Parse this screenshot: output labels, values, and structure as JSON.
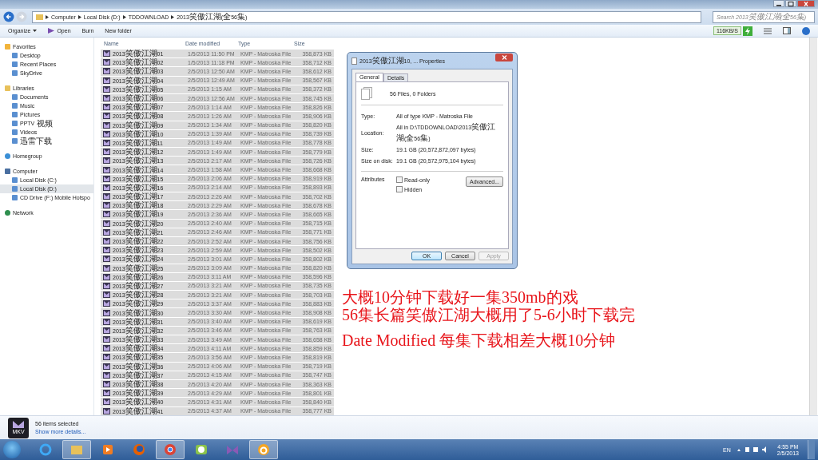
{
  "address_bar": {
    "breadcrumbs": [
      "Computer",
      "Local Disk (D:)",
      "TDDOWNLOAD",
      "2013笑傲江湖(全56集)"
    ],
    "search_placeholder": "Search 2013笑傲江湖(全56集)"
  },
  "toolbar": {
    "buttons": [
      {
        "label": "Organize",
        "kind": "menu"
      },
      {
        "label": "Open",
        "kind": "icon"
      },
      {
        "label": "Burn",
        "kind": "plain"
      },
      {
        "label": "New folder",
        "kind": "plain"
      }
    ],
    "speed": "116KB/S"
  },
  "sidebar": {
    "groups": [
      {
        "label": "Favorites",
        "selected": false,
        "children": [
          {
            "label": "Desktop",
            "selected": false
          },
          {
            "label": "Recent Places",
            "selected": false
          },
          {
            "label": "SkyDrive",
            "selected": false
          }
        ]
      },
      {
        "label": "Libraries",
        "selected": false,
        "children": [
          {
            "label": "Documents",
            "selected": false
          },
          {
            "label": "Music",
            "selected": false
          },
          {
            "label": "Pictures",
            "selected": false
          },
          {
            "label": "PPTV视频",
            "selected": false
          },
          {
            "label": "Videos",
            "selected": false
          },
          {
            "label": "迅雷下载",
            "selected": false
          }
        ]
      },
      {
        "label": "Homegroup",
        "selected": false
      },
      {
        "label": "Computer",
        "selected": false,
        "children": [
          {
            "label": "Local Disk (C:)",
            "selected": false
          },
          {
            "label": "Local Disk (D:)",
            "selected": true
          },
          {
            "label": "CD Drive (F:) Mobile Hotspo",
            "selected": false
          }
        ]
      },
      {
        "label": "Network",
        "selected": false
      }
    ]
  },
  "file_list": {
    "columns": [
      "Name",
      "Date modified",
      "Type",
      "Size"
    ],
    "rows": [
      {
        "name": "2013笑傲江湖01",
        "date": "1/5/2013 11:50 PM",
        "type": "KMP - Matroska File",
        "size": "358,873 KB",
        "selected": true
      },
      {
        "name": "2013笑傲江湖02",
        "date": "1/5/2013 11:18 PM",
        "type": "KMP - Matroska File",
        "size": "358,712 KB",
        "selected": true
      },
      {
        "name": "2013笑傲江湖03",
        "date": "2/5/2013 12:50 AM",
        "type": "KMP - Matroska File",
        "size": "358,612 KB",
        "selected": true
      },
      {
        "name": "2013笑傲江湖04",
        "date": "2/5/2013 12:49 AM",
        "type": "KMP - Matroska File",
        "size": "358,567 KB",
        "selected": true
      },
      {
        "name": "2013笑傲江湖05",
        "date": "2/5/2013 1:15 AM",
        "type": "KMP - Matroska File",
        "size": "358,372 KB",
        "selected": true
      },
      {
        "name": "2013笑傲江湖06",
        "date": "2/5/2013 12:56 AM",
        "type": "KMP - Matroska File",
        "size": "358,745 KB",
        "selected": true
      },
      {
        "name": "2013笑傲江湖07",
        "date": "2/5/2013 1:14 AM",
        "type": "KMP - Matroska File",
        "size": "358,826 KB",
        "selected": true
      },
      {
        "name": "2013笑傲江湖08",
        "date": "2/5/2013 1:26 AM",
        "type": "KMP - Matroska File",
        "size": "358,906 KB",
        "selected": true
      },
      {
        "name": "2013笑傲江湖09",
        "date": "2/5/2013 1:34 AM",
        "type": "KMP - Matroska File",
        "size": "358,820 KB",
        "selected": true
      },
      {
        "name": "2013笑傲江湖10",
        "date": "2/5/2013 1:39 AM",
        "type": "KMP - Matroska File",
        "size": "358,739 KB",
        "selected": true
      },
      {
        "name": "2013笑傲江湖11",
        "date": "2/5/2013 1:49 AM",
        "type": "KMP - Matroska File",
        "size": "358,778 KB",
        "selected": true
      },
      {
        "name": "2013笑傲江湖12",
        "date": "2/5/2013 1:49 AM",
        "type": "KMP - Matroska File",
        "size": "358,779 KB",
        "selected": true
      },
      {
        "name": "2013笑傲江湖13",
        "date": "2/5/2013 2:17 AM",
        "type": "KMP - Matroska File",
        "size": "358,726 KB",
        "selected": true
      },
      {
        "name": "2013笑傲江湖14",
        "date": "2/5/2013 1:58 AM",
        "type": "KMP - Matroska File",
        "size": "358,668 KB",
        "selected": true
      },
      {
        "name": "2013笑傲江湖15",
        "date": "2/5/2013 2:06 AM",
        "type": "KMP - Matroska File",
        "size": "358,919 KB",
        "selected": true
      },
      {
        "name": "2013笑傲江湖16",
        "date": "2/5/2013 2:14 AM",
        "type": "KMP - Matroska File",
        "size": "358,893 KB",
        "selected": true
      },
      {
        "name": "2013笑傲江湖17",
        "date": "2/5/2013 2:26 AM",
        "type": "KMP - Matroska File",
        "size": "358,702 KB",
        "selected": true
      },
      {
        "name": "2013笑傲江湖18",
        "date": "2/5/2013 2:29 AM",
        "type": "KMP - Matroska File",
        "size": "358,678 KB",
        "selected": true
      },
      {
        "name": "2013笑傲江湖19",
        "date": "2/5/2013 2:36 AM",
        "type": "KMP - Matroska File",
        "size": "358,665 KB",
        "selected": true
      },
      {
        "name": "2013笑傲江湖20",
        "date": "2/5/2013 2:40 AM",
        "type": "KMP - Matroska File",
        "size": "358,715 KB",
        "selected": true
      },
      {
        "name": "2013笑傲江湖21",
        "date": "2/5/2013 2:46 AM",
        "type": "KMP - Matroska File",
        "size": "358,771 KB",
        "selected": true
      },
      {
        "name": "2013笑傲江湖22",
        "date": "2/5/2013 2:52 AM",
        "type": "KMP - Matroska File",
        "size": "358,756 KB",
        "selected": true
      },
      {
        "name": "2013笑傲江湖23",
        "date": "2/5/2013 2:59 AM",
        "type": "KMP - Matroska File",
        "size": "358,502 KB",
        "selected": true
      },
      {
        "name": "2013笑傲江湖24",
        "date": "2/5/2013 3:01 AM",
        "type": "KMP - Matroska File",
        "size": "358,802 KB",
        "selected": true
      },
      {
        "name": "2013笑傲江湖25",
        "date": "2/5/2013 3:09 AM",
        "type": "KMP - Matroska File",
        "size": "358,820 KB",
        "selected": true
      },
      {
        "name": "2013笑傲江湖26",
        "date": "2/5/2013 3:11 AM",
        "type": "KMP - Matroska File",
        "size": "358,596 KB",
        "selected": true
      },
      {
        "name": "2013笑傲江湖27",
        "date": "2/5/2013 3:21 AM",
        "type": "KMP - Matroska File",
        "size": "358,735 KB",
        "selected": true
      },
      {
        "name": "2013笑傲江湖28",
        "date": "2/5/2013 3:21 AM",
        "type": "KMP - Matroska File",
        "size": "358,703 KB",
        "selected": true
      },
      {
        "name": "2013笑傲江湖29",
        "date": "2/5/2013 3:37 AM",
        "type": "KMP - Matroska File",
        "size": "358,883 KB",
        "selected": true
      },
      {
        "name": "2013笑傲江湖30",
        "date": "2/5/2013 3:30 AM",
        "type": "KMP - Matroska File",
        "size": "358,908 KB",
        "selected": true
      },
      {
        "name": "2013笑傲江湖31",
        "date": "2/5/2013 3:40 AM",
        "type": "KMP - Matroska File",
        "size": "358,619 KB",
        "selected": true
      },
      {
        "name": "2013笑傲江湖32",
        "date": "2/5/2013 3:46 AM",
        "type": "KMP - Matroska File",
        "size": "358,763 KB",
        "selected": true
      },
      {
        "name": "2013笑傲江湖33",
        "date": "2/5/2013 3:49 AM",
        "type": "KMP - Matroska File",
        "size": "358,658 KB",
        "selected": true
      },
      {
        "name": "2013笑傲江湖34",
        "date": "2/5/2013 4:11 AM",
        "type": "KMP - Matroska File",
        "size": "358,859 KB",
        "selected": true
      },
      {
        "name": "2013笑傲江湖35",
        "date": "2/5/2013 3:56 AM",
        "type": "KMP - Matroska File",
        "size": "358,819 KB",
        "selected": true
      },
      {
        "name": "2013笑傲江湖36",
        "date": "2/5/2013 4:06 AM",
        "type": "KMP - Matroska File",
        "size": "358,719 KB",
        "selected": true
      },
      {
        "name": "2013笑傲江湖37",
        "date": "2/5/2013 4:15 AM",
        "type": "KMP - Matroska File",
        "size": "358,747 KB",
        "selected": true
      },
      {
        "name": "2013笑傲江湖38",
        "date": "2/5/2013 4:20 AM",
        "type": "KMP - Matroska File",
        "size": "358,363 KB",
        "selected": true
      },
      {
        "name": "2013笑傲江湖39",
        "date": "2/5/2013 4:29 AM",
        "type": "KMP - Matroska File",
        "size": "358,801 KB",
        "selected": true
      },
      {
        "name": "2013笑傲江湖40",
        "date": "2/5/2013 4:31 AM",
        "type": "KMP - Matroska File",
        "size": "358,840 KB",
        "selected": true
      },
      {
        "name": "2013笑傲江湖41",
        "date": "2/5/2013 4:37 AM",
        "type": "KMP - Matroska File",
        "size": "358,777 KB",
        "selected": true
      }
    ]
  },
  "properties_dialog": {
    "title": "2013笑傲江湖10, ... Properties",
    "tabs": [
      {
        "label": "General",
        "selected": true
      },
      {
        "label": "Details",
        "selected": false
      }
    ],
    "summary": "56 Files, 0 Folders",
    "fields": [
      {
        "label": "Type:",
        "value": "All of type KMP - Matroska File"
      },
      {
        "label": "Location:",
        "value": "All in D:\\TDDOWNLOAD\\2013笑傲江湖(全56集)"
      },
      {
        "label": "Size:",
        "value": "19.1 GB (20,572,872,097 bytes)"
      },
      {
        "label": "Size on disk:",
        "value": "19.1 GB (20,572,975,104 bytes)"
      }
    ],
    "attributes_label": "Attributes",
    "checkboxes": [
      {
        "label": "Read-only",
        "checked": false
      },
      {
        "label": "Hidden",
        "checked": false
      }
    ],
    "advanced_button": "Advanced...",
    "buttons": [
      {
        "label": "OK",
        "disabled": false
      },
      {
        "label": "Cancel",
        "disabled": false
      },
      {
        "label": "Apply",
        "disabled": true
      }
    ]
  },
  "annotation": {
    "lines": [
      "大概10分钟下载好一集350mb的戏",
      "56集长篇笑傲江湖大概用了5-6小时下载完",
      "Date Modified 每集下载相差大概10分钟"
    ]
  },
  "details_pane": {
    "icon_label": "MKV",
    "count": "56 items selected",
    "link": "Show more details..."
  },
  "taskbar": {
    "apps": [
      {
        "active": false
      },
      {
        "active": true
      },
      {
        "active": false
      },
      {
        "active": false
      },
      {
        "active": true
      },
      {
        "active": false
      },
      {
        "active": false
      },
      {
        "active": true
      }
    ],
    "language": "EN",
    "time": "4:55 PM",
    "date": "2/5/2013"
  }
}
